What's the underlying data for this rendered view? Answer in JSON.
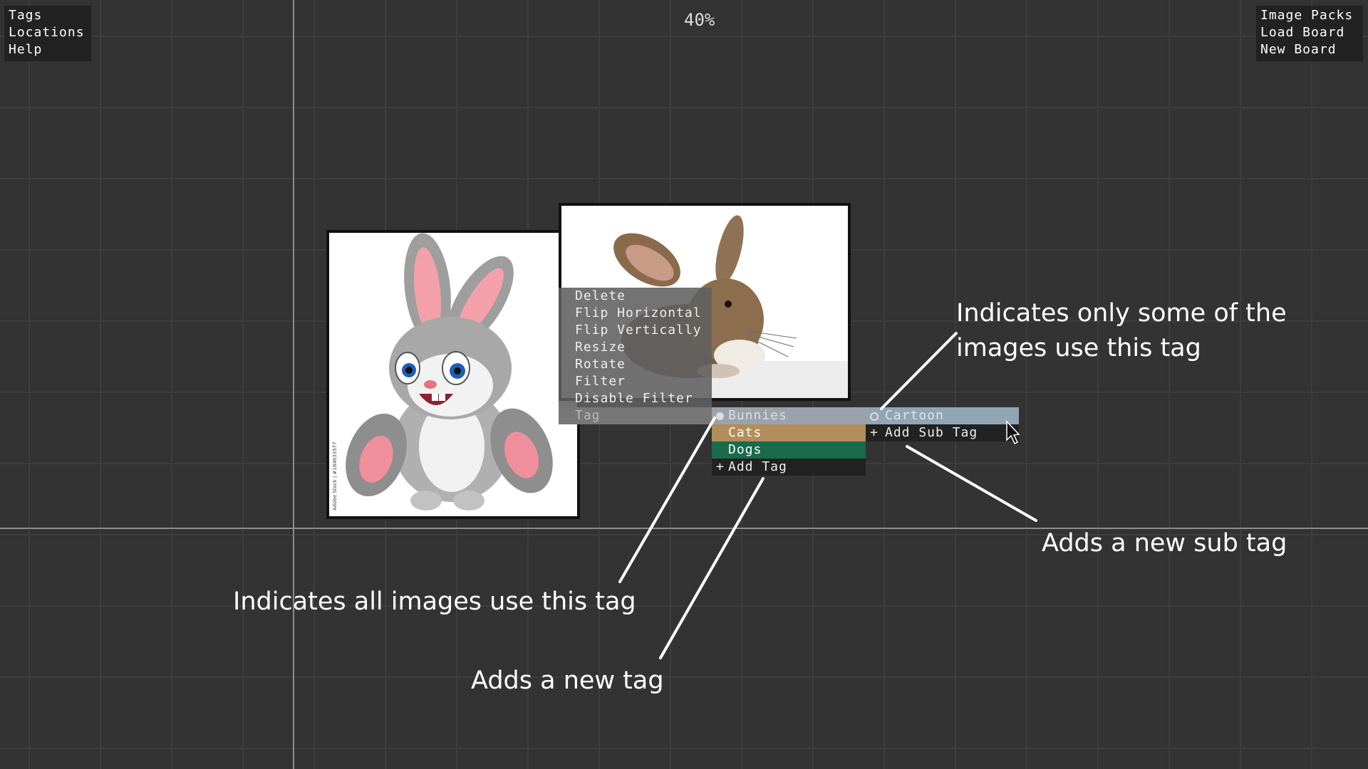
{
  "menu_left": {
    "items": [
      "Tags",
      "Locations",
      "Help"
    ]
  },
  "menu_right": {
    "items": [
      "Image Packs",
      "Load Board",
      "New Board"
    ]
  },
  "zoom": "40%",
  "context_menu": {
    "items": [
      "Delete",
      "Flip Horizontal",
      "Flip Vertically",
      "Resize",
      "Rotate",
      "Filter",
      "Disable Filter",
      "Tag"
    ]
  },
  "tags": [
    {
      "label": "Bunnies",
      "color": "#9ba2ab",
      "text_color": "#dcdfe3",
      "usage": "all"
    },
    {
      "label": "Cats",
      "color": "#b38d5a",
      "text_color": "#ffffff",
      "usage": "none"
    },
    {
      "label": "Dogs",
      "color": "#1a6b4e",
      "text_color": "#ffffff",
      "usage": "none"
    }
  ],
  "add_tag_label": "Add Tag",
  "sub_tags": [
    {
      "label": "Cartoon",
      "color": "#92a5b4",
      "text_color": "#dde4ea",
      "usage": "some"
    }
  ],
  "add_sub_tag_label": "Add Sub Tag",
  "annotations": {
    "some_line1": "Indicates only some of the",
    "some_line2": "images use this tag",
    "all": "Indicates all images use this tag",
    "new_tag": "Adds a new tag",
    "new_sub_tag": "Adds a new sub tag"
  },
  "images": {
    "cartoon_watermark": "Adobe Stock | #184633577"
  }
}
